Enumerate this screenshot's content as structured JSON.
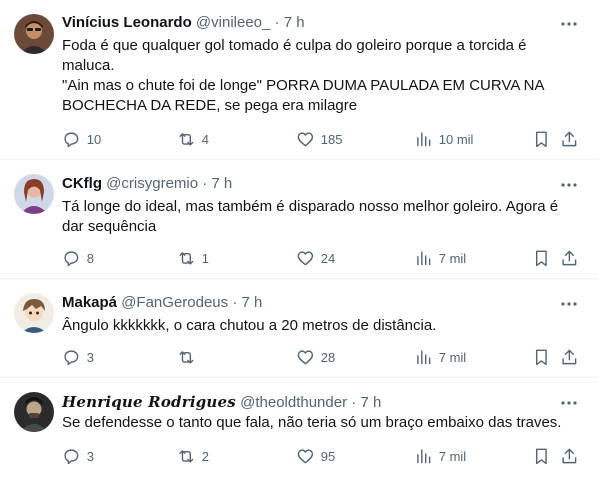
{
  "tweets": [
    {
      "name": "Vinícius Leonardo",
      "handle": "@vinileeo_",
      "dot": "·",
      "time": "7 h",
      "lines": [
        "Foda é que qualquer gol tomado é culpa do goleiro porque a torcida é",
        "maluca.",
        "\"Ain mas o chute foi de longe\" PORRA DUMA PAULADA EM CURVA NA",
        "BOCHECHA DA REDE, se pega era milagre"
      ],
      "replies": "10",
      "retweets": "4",
      "likes": "185",
      "views": "10 mil"
    },
    {
      "name": "CKflg",
      "handle": "@crisygremio",
      "dot": "·",
      "time": "7 h",
      "lines": [
        "Tá longe do ideal, mas também é disparado nosso melhor goleiro. Agora é",
        "dar sequência"
      ],
      "replies": "8",
      "retweets": "1",
      "likes": "24",
      "views": "7 mil"
    },
    {
      "name": "Makapá",
      "handle": "@FanGerodeus",
      "dot": "·",
      "time": "7 h",
      "lines": [
        "Ângulo kkkkkkk, o cara chutou a 20 metros de distância."
      ],
      "replies": "3",
      "retweets": "",
      "likes": "28",
      "views": "7 mil"
    },
    {
      "name": "Henrique Rodrigues",
      "handle": "@theoldthunder",
      "dot": "·",
      "time": "7 h",
      "lines": [
        "Se defendesse o tanto que fala, não teria só um braço embaixo das traves."
      ],
      "replies": "3",
      "retweets": "2",
      "likes": "95",
      "views": "7 mil"
    }
  ],
  "icons": {
    "reply": "reply-icon",
    "retweet": "retweet-icon",
    "like": "heart-icon",
    "views": "views-icon",
    "bookmark": "bookmark-icon",
    "share": "share-icon",
    "more": "more-icon"
  },
  "colors": {
    "text": "#0f1419",
    "secondary": "#536471",
    "divider": "#eff3f4"
  }
}
